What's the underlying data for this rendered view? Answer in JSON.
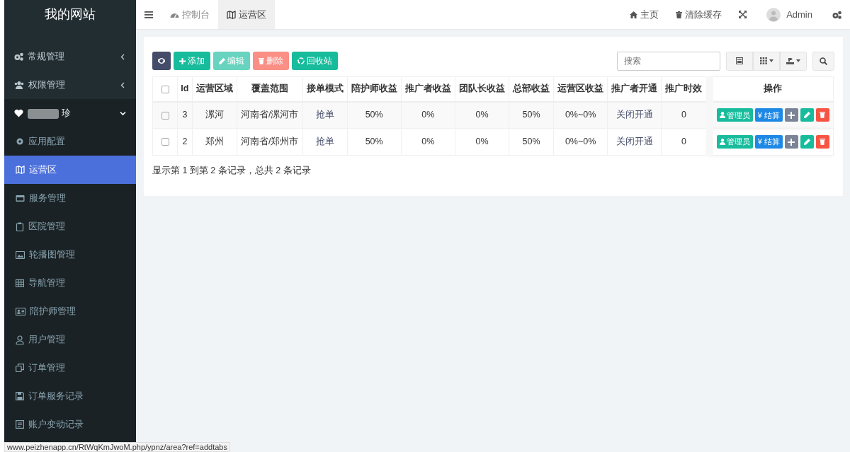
{
  "sidebar": {
    "title": "我的网站",
    "items": [
      {
        "label": "常规管理",
        "expanded": false
      },
      {
        "label": "权限管理",
        "expanded": false
      },
      {
        "label": "珍",
        "redacted": true,
        "expanded": true,
        "children": [
          {
            "label": "应用配置",
            "selected": false
          },
          {
            "label": "运营区",
            "selected": true
          },
          {
            "label": "服务管理",
            "selected": false
          },
          {
            "label": "医院管理",
            "selected": false
          },
          {
            "label": "轮播图管理",
            "selected": false
          },
          {
            "label": "导航管理",
            "selected": false
          },
          {
            "label": "陪护师管理",
            "selected": false
          },
          {
            "label": "用户管理",
            "selected": false
          },
          {
            "label": "订单管理",
            "selected": false
          },
          {
            "label": "订单服务记录",
            "selected": false
          },
          {
            "label": "账户变动记录",
            "selected": false
          }
        ]
      }
    ]
  },
  "topbar": {
    "tabs": [
      {
        "label": "控制台",
        "selected": false
      },
      {
        "label": "运营区",
        "selected": true
      }
    ],
    "links": [
      "主页",
      "清除缓存"
    ],
    "user": "Admin"
  },
  "toolbar": {
    "buttons": [
      {
        "kind": "refresh",
        "disabled": false
      },
      {
        "kind": "add",
        "label": "添加",
        "disabled": false
      },
      {
        "kind": "edit",
        "label": "编辑",
        "disabled": true
      },
      {
        "kind": "delete",
        "label": "删除",
        "disabled": true
      },
      {
        "kind": "recycle",
        "label": "回收站",
        "disabled": false
      }
    ],
    "search": {
      "placeholder": "搜索"
    }
  },
  "table": {
    "select_all": false,
    "columns": [
      "Id",
      "运营区域",
      "覆盖范围",
      "接单模式",
      "陪护师收益",
      "推广者收益",
      "团队长收益",
      "总部收益",
      "运营区收益",
      "推广者开通",
      "推广时效",
      "操作"
    ],
    "rows": [
      {
        "selected": false,
        "cells": [
          "3",
          "漯河",
          "河南省/漯河市",
          "抢单",
          "50%",
          "0%",
          "0%",
          "50%",
          "0%~0%",
          "关闭开通",
          "0"
        ],
        "actions": [
          "管理员",
          "¥ 结算"
        ]
      },
      {
        "selected": false,
        "cells": [
          "2",
          "郑州",
          "河南省/郑州市",
          "抢单",
          "50%",
          "0%",
          "0%",
          "50%",
          "0%~0%",
          "关闭开通",
          "0"
        ],
        "actions": [
          "管理员",
          "¥ 结算"
        ]
      }
    ]
  },
  "pagination_info": "显示第 1 到第 2 条记录，总共 2 条记录",
  "status_url": "www.peizhenapp.cn/RtWqKmJwoM.php/ypnz/area?ref=addtabs"
}
